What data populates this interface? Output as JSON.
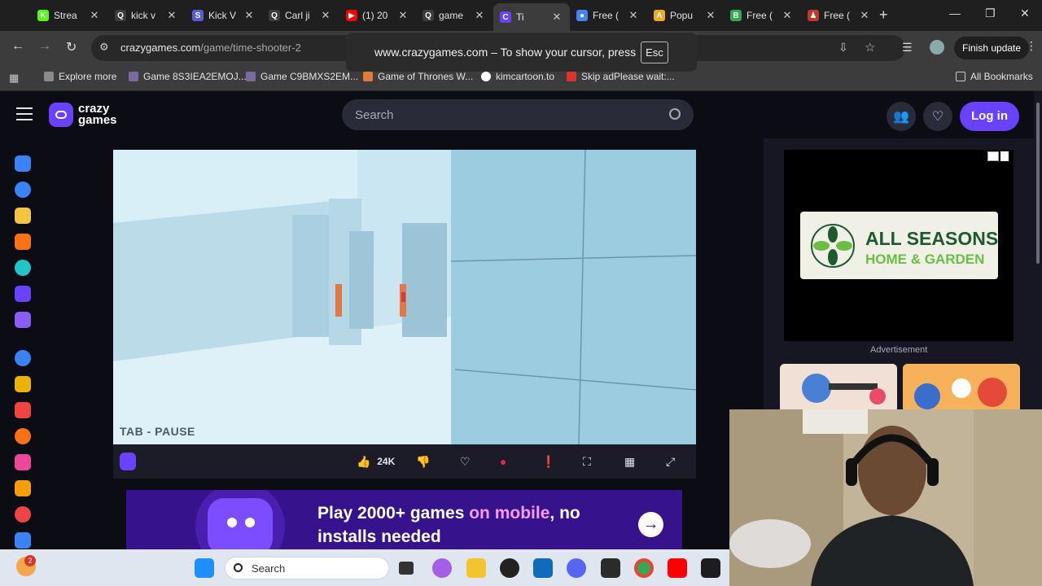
{
  "browser": {
    "tabs": [
      {
        "label": "Strea",
        "favicon_color": "#53fc18",
        "favicon_char": "K"
      },
      {
        "label": "kick v",
        "favicon_color": "#3c3c3c",
        "favicon_char": "Q"
      },
      {
        "label": "Kick V",
        "favicon_color": "#5b5bd6",
        "favicon_char": "S"
      },
      {
        "label": "Carl ji",
        "favicon_color": "#3c3c3c",
        "favicon_char": "Q"
      },
      {
        "label": "(1) 20",
        "favicon_color": "#ff0000",
        "favicon_char": "▶"
      },
      {
        "label": "game",
        "favicon_color": "#3c3c3c",
        "favicon_char": "Q"
      },
      {
        "label": "Ti",
        "favicon_color": "#6842ff",
        "favicon_char": "C"
      },
      {
        "label": "Free (",
        "favicon_color": "#4285f4",
        "favicon_char": "●"
      },
      {
        "label": "Popu",
        "favicon_color": "#f3a623",
        "favicon_char": "A"
      },
      {
        "label": "Free (",
        "favicon_color": "#34a853",
        "favicon_char": "B"
      },
      {
        "label": "Free (",
        "favicon_color": "#c0392b",
        "favicon_char": "♟"
      }
    ],
    "url_host": "crazygames.com",
    "url_path": "/game/time-shooter-2",
    "finish_update": "Finish update",
    "bookmarks": [
      {
        "label": "Explore more",
        "color": "#8a8a8a"
      },
      {
        "label": "Game 8S3IEA2EMOJ...",
        "color": "#7a6aa0"
      },
      {
        "label": "Game C9BMXS2EM...",
        "color": "#7a6aa0"
      },
      {
        "label": "Game of Thrones W...",
        "color": "#e07b39"
      },
      {
        "label": "kimcartoon.to",
        "color": "#ffffff"
      },
      {
        "label": "Skip adPlease wait:...",
        "color": "#d9352b"
      }
    ],
    "all_bookmarks": "All Bookmarks"
  },
  "toast": {
    "text": "www.crazygames.com – To show your cursor, press",
    "key": "Esc"
  },
  "site": {
    "logo_line1": "crazy",
    "logo_line2": "games",
    "search_placeholder": "Search",
    "login": "Log in",
    "sidebar_icons": [
      {
        "name": "home-icon",
        "color": "#3b82f6"
      },
      {
        "name": "recent-icon",
        "color": "#3b82f6"
      },
      {
        "name": "new-icon",
        "color": "#f5c542"
      },
      {
        "name": "trending-icon",
        "color": "#f97316"
      },
      {
        "name": "updated-icon",
        "color": "#22c5c5"
      },
      {
        "name": "originals-icon",
        "color": "#6842ff"
      },
      {
        "name": "multiplayer-icon",
        "color": "#8b5cf6"
      },
      {
        "name": "two-player-icon",
        "color": "#3b82f6"
      },
      {
        "name": "action-icon",
        "color": "#eab308"
      },
      {
        "name": "adventure-icon",
        "color": "#ef4444"
      },
      {
        "name": "basketball-icon",
        "color": "#f97316"
      },
      {
        "name": "beauty-icon",
        "color": "#ec4899"
      },
      {
        "name": "car-icon",
        "color": "#f59e0b"
      },
      {
        "name": "card-icon",
        "color": "#ef4444"
      },
      {
        "name": "clicker-icon",
        "color": "#3b82f6"
      }
    ]
  },
  "game": {
    "pause_hint": "TAB - PAUSE",
    "likes": "24K"
  },
  "banner": {
    "line1_a": "Play 2000+ games ",
    "line1_b": "on mobile",
    "line1_c": ", no",
    "line2": "installs needed"
  },
  "ad": {
    "brand_line1": "ALL SEASONS",
    "brand_line2": "HOME & GARDEN",
    "label": "Advertisement"
  },
  "taskbar": {
    "search": "Search",
    "notification_count": "2"
  }
}
